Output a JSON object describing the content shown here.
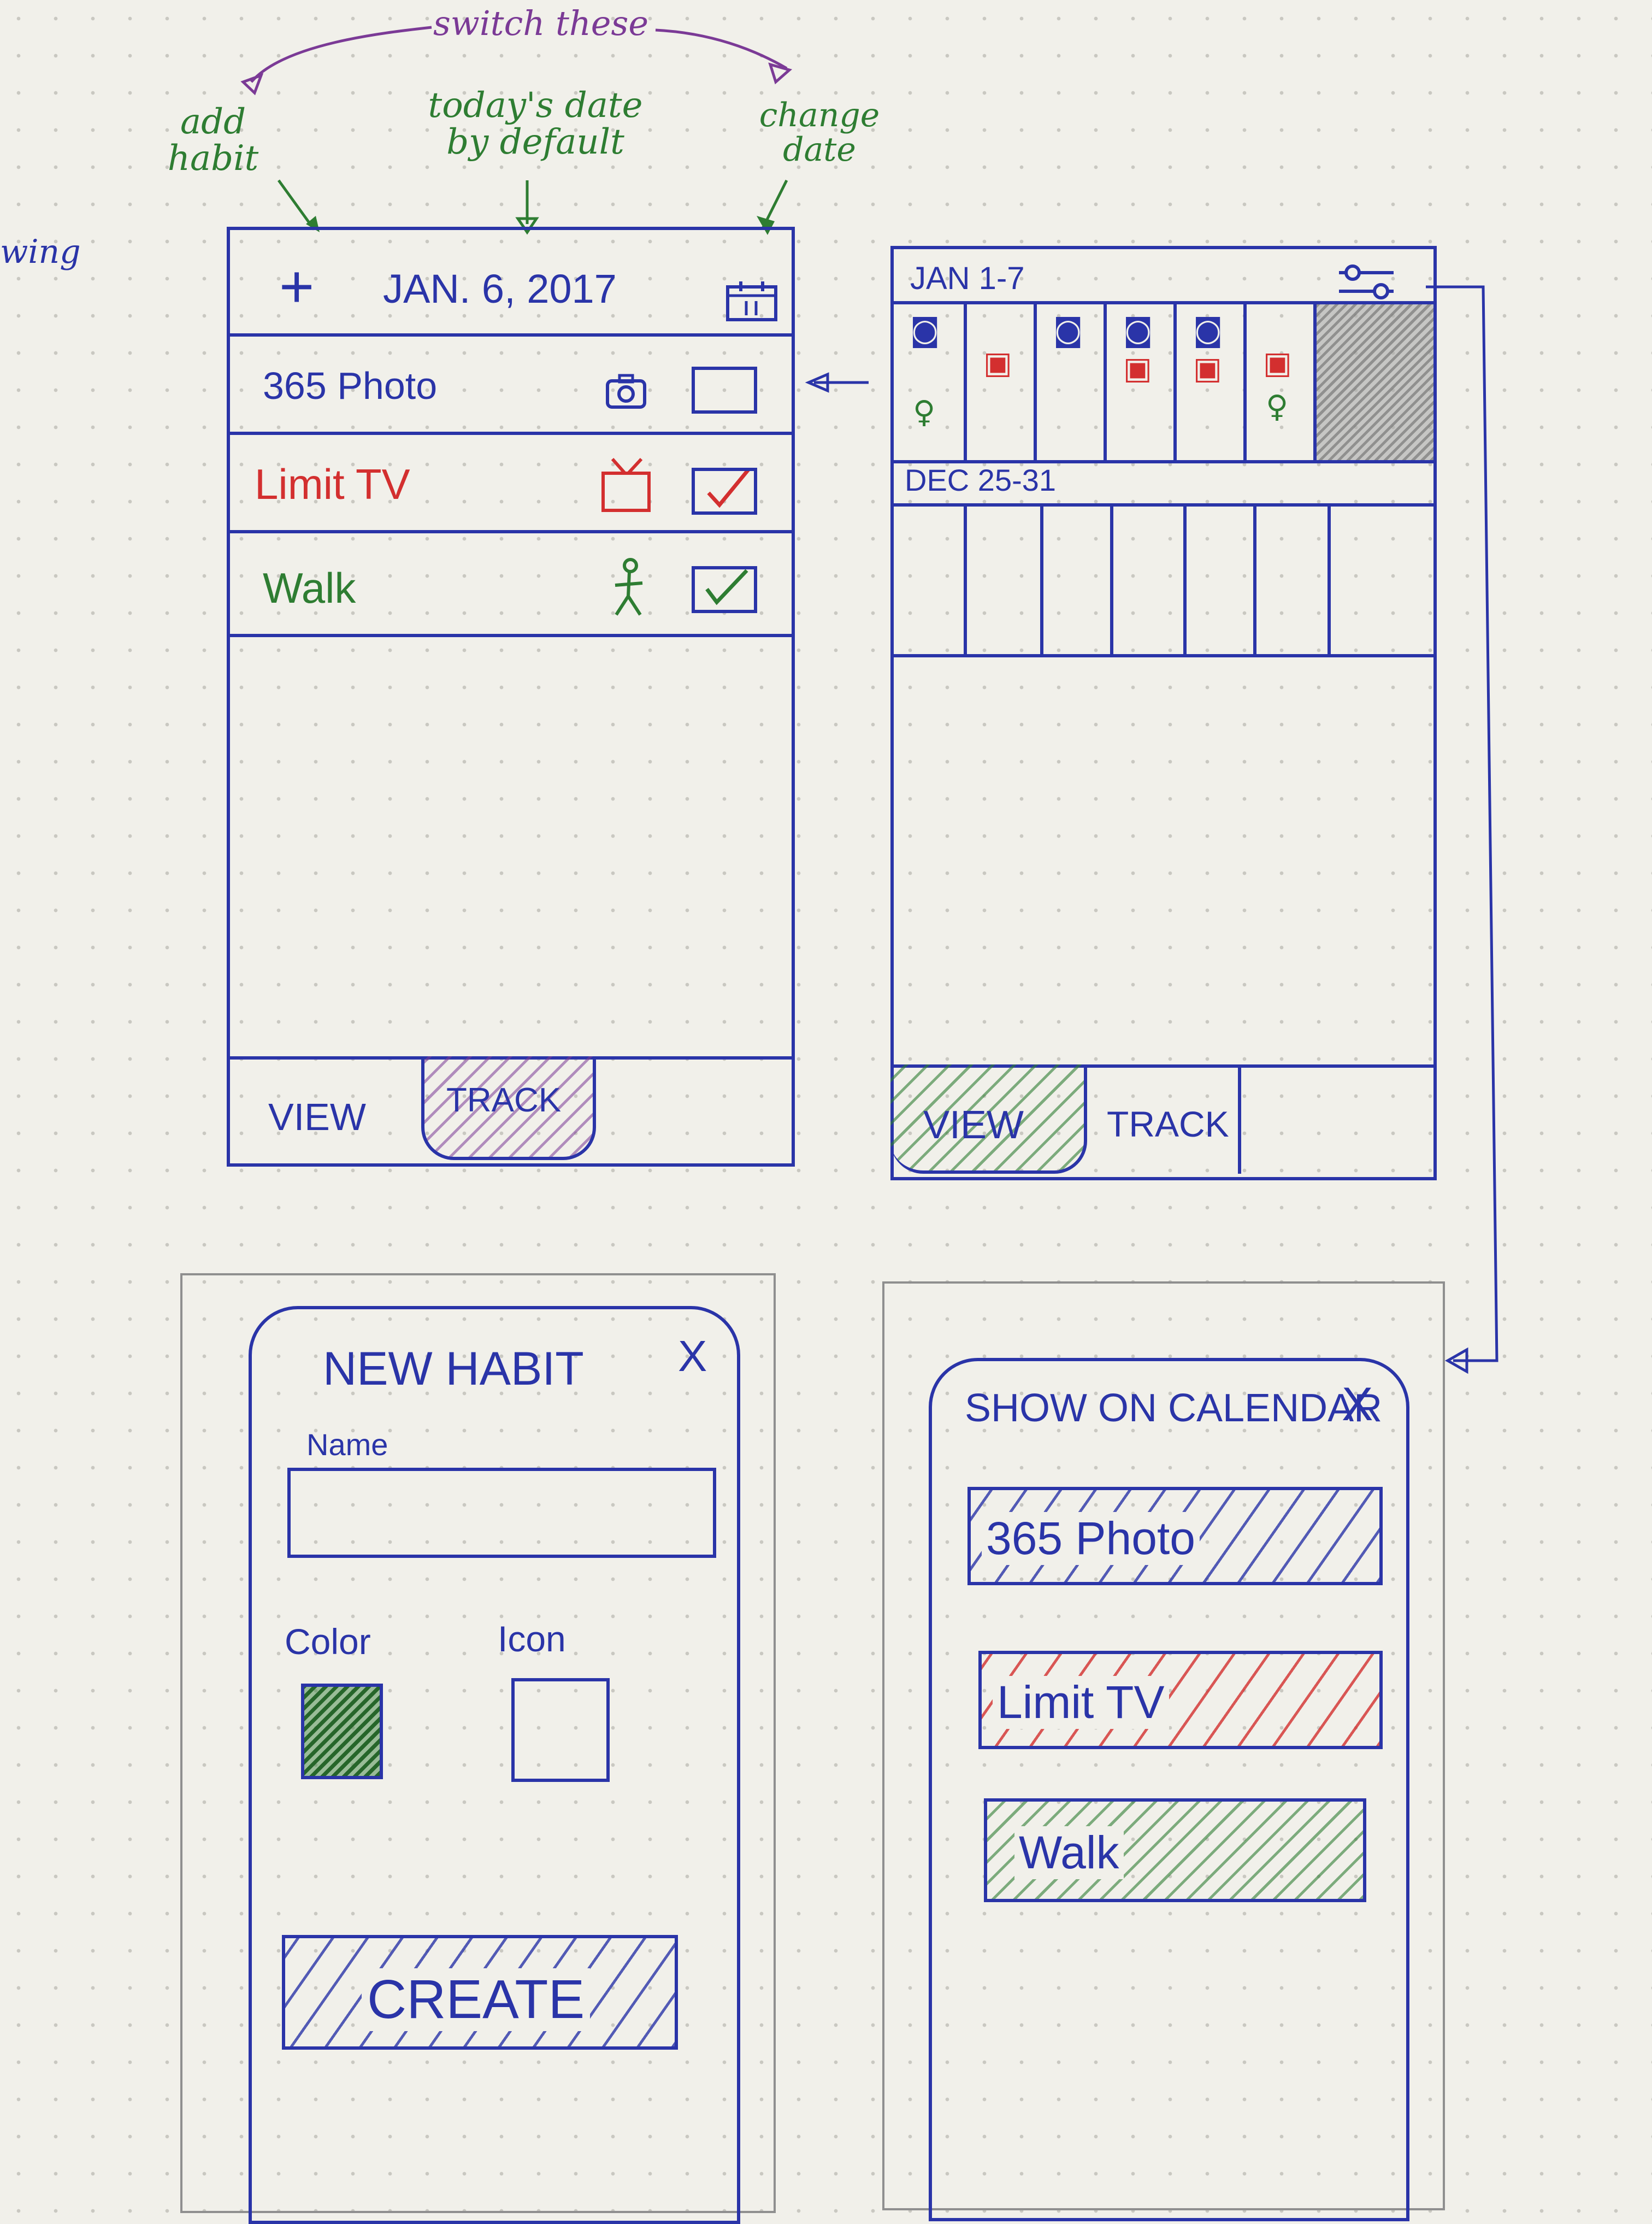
{
  "annotations": {
    "switch_these": "switch these",
    "add_habit": "add habit",
    "todays_date": "today's date by default",
    "change_date": "change date",
    "partial_left": "wing"
  },
  "track_screen": {
    "add_symbol": "+",
    "date": "JAN. 6, 2017",
    "calendar_icon": "calendar-icon",
    "habits": [
      {
        "name": "365 Photo",
        "icon": "camera-icon",
        "color": "#2a34a8",
        "checked": false
      },
      {
        "name": "Limit TV",
        "icon": "tv-icon",
        "color": "#d32f2f",
        "checked": true
      },
      {
        "name": "Walk",
        "icon": "walker-icon",
        "color": "#2e7d32",
        "checked": true
      }
    ],
    "tabs": {
      "view": "VIEW",
      "track": "TRACK"
    }
  },
  "view_screen": {
    "week1": "JAN 1-7",
    "week2": "DEC 25-31",
    "filter_icon": "sliders-icon",
    "tabs": {
      "view": "VIEW",
      "track": "TRACK"
    }
  },
  "new_habit": {
    "title": "NEW HABIT",
    "close": "X",
    "name_label": "Name",
    "color_label": "Color",
    "icon_label": "Icon",
    "create": "CREATE"
  },
  "show_on_calendar": {
    "title": "SHOW ON CALENDAR",
    "close": "X",
    "items": [
      {
        "name": "365 Photo",
        "color": "#2a34a8"
      },
      {
        "name": "Limit TV",
        "color": "#d32f2f"
      },
      {
        "name": "Walk",
        "color": "#2e7d32"
      }
    ]
  },
  "colors": {
    "ink": "#2a34a8",
    "green": "#2e7d32",
    "red": "#d32f2f",
    "purple": "#7b3a96"
  }
}
